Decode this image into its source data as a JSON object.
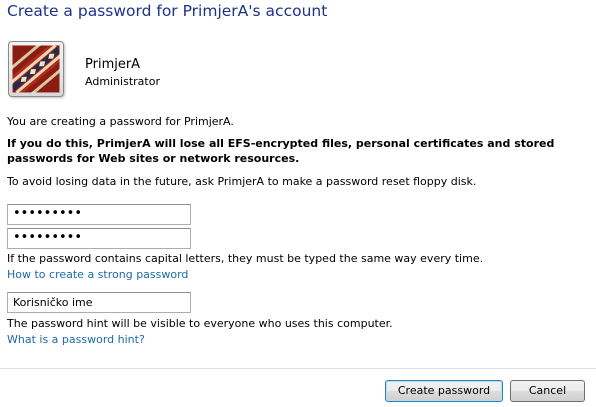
{
  "title": "Create a password for PrimjerA's account",
  "user": {
    "name": "PrimjerA",
    "role": "Administrator",
    "avatar_icon": "carpet-picture-icon"
  },
  "messages": {
    "creating": "You are creating a password for PrimjerA.",
    "warning": "If you do this, PrimjerA will lose all EFS-encrypted files, personal certificates and stored passwords for Web sites or network resources.",
    "reset_hint": "To avoid losing data in the future, ask PrimjerA to make a password reset floppy disk."
  },
  "fields": {
    "new_password": "•••••••••",
    "confirm_password": "•••••••••",
    "hint_value": "Korisničko ime"
  },
  "info": {
    "capital_letters": "If the password contains capital letters, they must be typed the same way every time.",
    "strong_password_link": "How to create a strong password",
    "hint_visibility": "The password hint will be visible to everyone who uses this computer.",
    "what_is_hint_link": "What is a password hint?"
  },
  "buttons": {
    "create": "Create password",
    "cancel": "Cancel"
  },
  "colors": {
    "title": "#1e3287",
    "link": "#1c6aa8"
  }
}
